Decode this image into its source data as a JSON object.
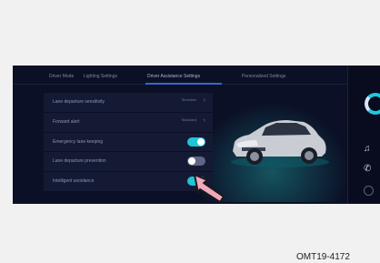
{
  "screen": {
    "tabs": [
      "Driver Mode",
      "Lighting Settings",
      "Driver Assistance Settings",
      "Personalized Settings"
    ],
    "active_tab": "Driver Assistance Settings",
    "settings": [
      {
        "label": "Lane departure sensitivity",
        "value": "Sensitive",
        "control": "select"
      },
      {
        "label": "Forward alert",
        "value": "Standard",
        "control": "select"
      },
      {
        "label": "Emergency lane keeping",
        "control": "toggle",
        "state": "on"
      },
      {
        "label": "Lane departure prevention",
        "control": "toggle",
        "state": "off"
      },
      {
        "label": "Intelligent avoidance",
        "control": "toggle",
        "state": "on"
      }
    ],
    "colors": {
      "toggle_on": "#1fc4d8",
      "toggle_off": "#5e6685",
      "accent": "#3c64c8"
    },
    "right_bar_icons": [
      "media-ring-icon",
      "music-note-icon",
      "phone-icon",
      "home-icon"
    ]
  },
  "caption": "OMT19-4172"
}
